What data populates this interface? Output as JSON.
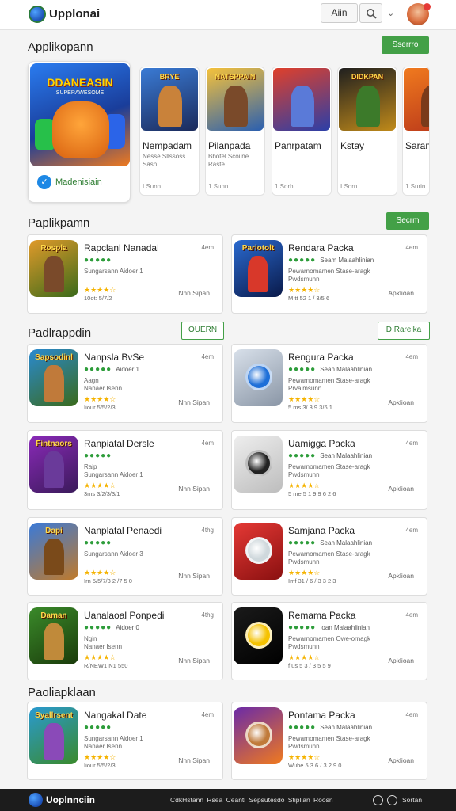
{
  "header": {
    "brand": "Upplonai",
    "button_label": "Aiin",
    "icons": [
      "globe-logo-icon",
      "search-icon",
      "chevron-down-icon",
      "avatar"
    ]
  },
  "sections": {
    "featured": {
      "title": "Applikopann",
      "button": "Sserrro"
    },
    "second": {
      "title": "Paplikpamn",
      "button": "Secrm"
    },
    "third": {
      "title": "Padlrappdin",
      "button_left": "OUERN",
      "button_right": "D Rarelka"
    },
    "fourth": {
      "title": "Paoliapklaan"
    }
  },
  "featured_card": {
    "art_title": "DDANEASIN",
    "art_subtitle": "SUPERAWESOME",
    "label": "Madenisiain"
  },
  "small_cards": [
    {
      "art_title": "BRYE",
      "name": "Nempadam",
      "sub1": "Nesse Sllssoss",
      "sub2": "Sasn",
      "foot": "I Sunn",
      "c1": "#3a7bd5",
      "c2": "#1b2a5a",
      "fig": "#c9823a"
    },
    {
      "art_title": "NATSPPAIN",
      "name": "Pilanpada",
      "sub1": "Bbotel Scoiine",
      "sub2": "Raste",
      "foot": "1 Sunn",
      "c1": "#f6c23a",
      "c2": "#2a5fb0",
      "fig": "#7a4a2a"
    },
    {
      "art_title": "",
      "name": "Panrpatam",
      "sub1": "",
      "sub2": "",
      "foot": "1 Sorh",
      "c1": "#e0402a",
      "c2": "#2b3fa8",
      "fig": "#5a7ad8"
    },
    {
      "art_title": "DIDKPAN",
      "name": "Kstay",
      "sub1": "",
      "sub2": "",
      "foot": "I Sorn",
      "c1": "#1f1f1f",
      "c2": "#c08a1a",
      "fig": "#3c7a2a"
    },
    {
      "art_title": "",
      "name": "Saran",
      "sub1": "",
      "sub2": "",
      "foot": "1 Surin",
      "c1": "#f07a1e",
      "c2": "#b8361a",
      "fig": "#7a3a1a"
    }
  ],
  "cards": [
    {
      "title": "Rapclanl Nanadal",
      "meta": "4em",
      "dots": "●●●●●",
      "dots_text": "",
      "sub1": "Sungarsann  Aidoer  1",
      "sub2": "",
      "stars": "★★★★☆",
      "num": "10ot: 5/7/2",
      "action": "Nhn Sipan",
      "c1": "#e09a2a",
      "c2": "#3a6a1a",
      "art": "Rospla",
      "fig": "#7a4a2a"
    },
    {
      "title": "Rendara Packa",
      "meta": "4em",
      "dots": "●●●●●",
      "dots_text": "Seam Malaahlinian",
      "sub1": "Pewarnomamen  Stase-aragk",
      "sub2": "Pwdsmunn",
      "stars": "★★★★☆",
      "num": "M tt 52 1 / 3/5 6",
      "action": "Apklioan",
      "c1": "#2a6ad0",
      "c2": "#0a1a4a",
      "art": "Pariotolt",
      "fig": "#d8382a"
    },
    {
      "title": "Nanpsla BvSe",
      "meta": "4em",
      "dots": "●●●●●",
      "dots_text": "Aidoer  1",
      "sub1": "Aagn",
      "sub2": "Nanaer Isenn",
      "stars": "★★★★☆",
      "num": "Iiour 5/5/2/3",
      "action": "Nhn Sipan",
      "c1": "#2a8ad0",
      "c2": "#3a6a1a",
      "art": "Sapsodinl",
      "fig": "#c07a3a"
    },
    {
      "title": "Rengura Packa",
      "meta": "4em",
      "dots": "●●●●●",
      "dots_text": "Sean Malaahlinian",
      "sub1": "Pewarnomamen  Stase-aragk",
      "sub2": "Prvaimsunn",
      "stars": "★★★★☆",
      "num": "5 ms 3/ 3 9 3/6 1",
      "action": "Apklioan",
      "c1": "#d8e0ea",
      "c2": "#8a96a6",
      "art": "",
      "fig": "#1e6fd8"
    },
    {
      "title": "Ranpiatal Dersle",
      "meta": "4em",
      "dots": "●●●●●",
      "dots_text": "",
      "sub1": "Raip",
      "sub2": "Sungarsann  Aidoer  1",
      "stars": "★★★★☆",
      "num": "3ms 3/2/3/3/1",
      "action": "Nhn Sipan",
      "c1": "#8a2ab8",
      "c2": "#3a1a5a",
      "art": "Fintnaors",
      "fig": "#6a3a9a"
    },
    {
      "title": "Uamigga Packa",
      "meta": "4em",
      "dots": "●●●●●",
      "dots_text": "Sean Malaahlinian",
      "sub1": "Pewarnomamen  Stase-aragk",
      "sub2": "Pwdsmunn",
      "stars": "★★★★☆",
      "num": "5 me 5 1 9 9 6 2 6",
      "action": "Apklioan",
      "c1": "#eeeeee",
      "c2": "#bdbdbd",
      "art": "",
      "fig": "#222"
    },
    {
      "title": "Nanplatal Penaedi",
      "meta": "4thg",
      "dots": "●●●●●",
      "dots_text": "",
      "sub1": "Sungarsann  Aidoer  3",
      "sub2": "",
      "stars": "★★★★☆",
      "num": "Irn 5/5/7/3 2 /7 5 0",
      "action": "Nhn Sipan",
      "c1": "#3a7ad8",
      "c2": "#c07a2a",
      "art": "Dapi",
      "fig": "#7a4a1a"
    },
    {
      "title": "Samjana Packa",
      "meta": "4em",
      "dots": "●●●●●",
      "dots_text": "Sean Malaahlinian",
      "sub1": "Pewarnomamen  Stase-aragk",
      "sub2": "Pwdsmunn",
      "stars": "★★★★☆",
      "num": "Imf 31 / 6 / 3 3 2 3",
      "action": "Apklioan",
      "c1": "#e53935",
      "c2": "#8a1010",
      "art": "",
      "fig": "#cfd8dc"
    },
    {
      "title": "Uanalaoal Ponpedi",
      "meta": "4thg",
      "dots": "●●●●●",
      "dots_text": "Aidoer  0",
      "sub1": "Ngin",
      "sub2": "Nanaer Isenn",
      "stars": "★★★★☆",
      "num": "R/NEW1 N1 550",
      "action": "Nhn Sipan",
      "c1": "#3a8a2a",
      "c2": "#1a3a0a",
      "art": "Daman",
      "fig": "#c08a3a"
    },
    {
      "title": "Remama Packa",
      "meta": "4em",
      "dots": "●●●●●",
      "dots_text": "Ioan Malaahlinian",
      "sub1": "Pewarnomamen  Owe-ornagk",
      "sub2": "Pwdsmunn",
      "stars": "★★★★☆",
      "num": "f us 5 3 / 3 5 5 9",
      "action": "Apklioan",
      "c1": "#1a1a1a",
      "c2": "#000",
      "art": "",
      "fig": "#f5c200"
    },
    {
      "title": "Nangakal Date",
      "meta": "4em",
      "dots": "●●●●●",
      "dots_text": "",
      "sub1": "Sungarsann  Aidoer  1",
      "sub2": "Nanaer Isenn",
      "stars": "★★★★☆",
      "num": "Iiour 5/5/2/3",
      "action": "Nhn Sipan",
      "c1": "#2a9ad0",
      "c2": "#3a8a2a",
      "art": "Syallrsent",
      "fig": "#8a4ab8"
    },
    {
      "title": "Pontama Packa",
      "meta": "4em",
      "dots": "●●●●●",
      "dots_text": "Sean Malaahlinian",
      "sub1": "Pewarnomamen  Stase-aragk",
      "sub2": "Pwdsmunn",
      "stars": "★★★★☆",
      "num": "Wuhe 5 3 6 / 3 2 9 0",
      "action": "Apklioan",
      "c1": "#6a2aa8",
      "c2": "#f07a1e",
      "art": "",
      "fig": "#c07a3a"
    }
  ],
  "footer": {
    "brand": "Uoplnnciin",
    "links": "CdkHstann  Rsea  Ceanti  Sepsutesdo  Stiplian  Roosn",
    "right_text": "Sortan"
  }
}
